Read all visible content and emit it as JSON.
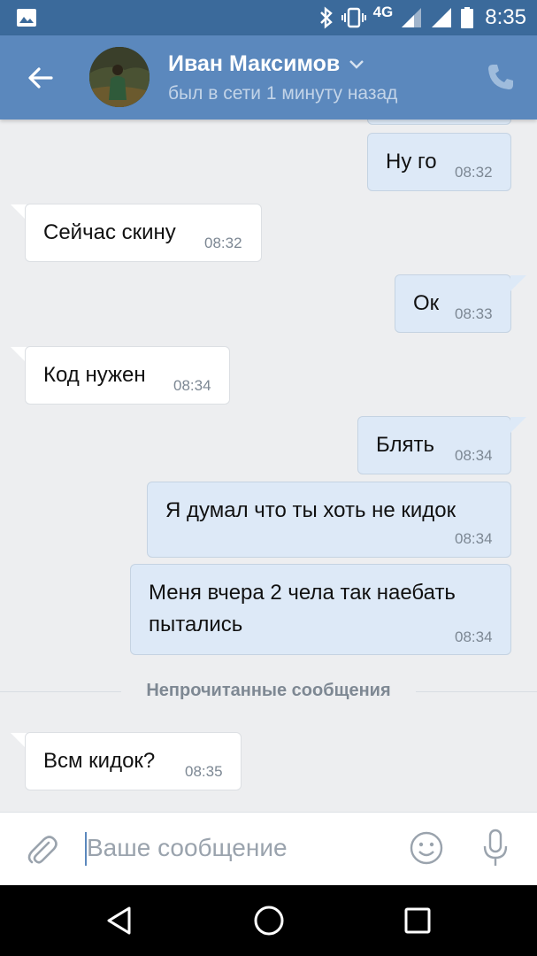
{
  "status_bar": {
    "network": "4G",
    "time": "8:35",
    "icons": [
      "image-icon",
      "bluetooth-icon",
      "vibrate-icon",
      "signal-icon",
      "signal-icon",
      "battery-icon"
    ]
  },
  "header": {
    "contact_name": "Иван Максимов",
    "contact_status": "был в сети 1 минуту назад",
    "icons": [
      "back-arrow-icon",
      "chevron-down-icon",
      "phone-icon"
    ]
  },
  "messages": [
    {
      "dir": "out",
      "text": "Ну го",
      "time": "08:32"
    },
    {
      "dir": "in",
      "text": "Сейчас скину",
      "time": "08:32"
    },
    {
      "dir": "out",
      "text": "Ок",
      "time": "08:33"
    },
    {
      "dir": "in",
      "text": "Код нужен",
      "time": "08:34"
    },
    {
      "dir": "out",
      "text": "Блять",
      "time": "08:34"
    },
    {
      "dir": "out",
      "text": "Я думал что ты хоть не кидок",
      "time": "08:34"
    },
    {
      "dir": "out",
      "text_lines": [
        "Меня вчера 2 чела так наебать",
        "пытались"
      ],
      "time": "08:34"
    },
    {
      "dir": "in",
      "text": "Всм кидок?",
      "time": "08:35"
    }
  ],
  "unread_divider": "Непрочитанные сообщения",
  "composer": {
    "placeholder": "Ваше сообщение",
    "icons": [
      "paperclip-icon",
      "emoji-icon",
      "microphone-icon"
    ]
  },
  "nav_bar": {
    "icons": [
      "back-triangle-icon",
      "home-circle-icon",
      "recents-square-icon"
    ]
  },
  "colors": {
    "status_bar": "#3b6a9b",
    "app_bar": "#5b88bd",
    "chat_background": "#edeef0",
    "outgoing_bubble": "#dde9f7",
    "incoming_bubble": "#ffffff"
  }
}
